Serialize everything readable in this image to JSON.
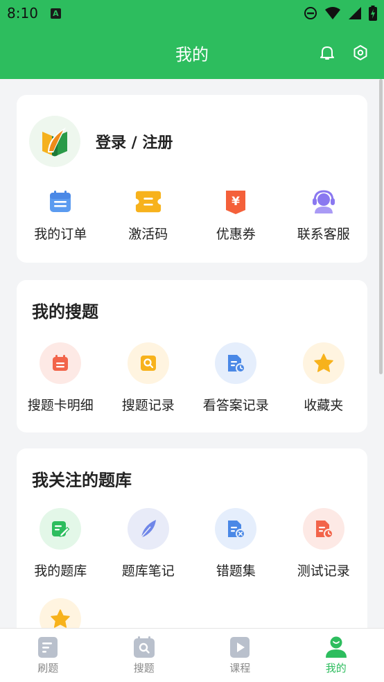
{
  "status": {
    "time": "8:10",
    "app_icon_letter": "A"
  },
  "header": {
    "title": "我的"
  },
  "login": {
    "label": "登录 / 注册"
  },
  "account_items": [
    {
      "label": "我的订单",
      "icon": "order-icon"
    },
    {
      "label": "激活码",
      "icon": "ticket-icon"
    },
    {
      "label": "优惠券",
      "icon": "coupon-icon"
    },
    {
      "label": "联系客服",
      "icon": "support-icon"
    }
  ],
  "search_section": {
    "title": "我的搜题",
    "items": [
      {
        "label": "搜题卡明细",
        "icon": "calendar-icon"
      },
      {
        "label": "搜题记录",
        "icon": "search-doc-icon"
      },
      {
        "label": "看答案记录",
        "icon": "doc-clock-icon"
      },
      {
        "label": "收藏夹",
        "icon": "star-icon"
      }
    ]
  },
  "library_section": {
    "title": "我关注的题库",
    "items": [
      {
        "label": "我的题库",
        "icon": "note-edit-icon"
      },
      {
        "label": "题库笔记",
        "icon": "feather-icon"
      },
      {
        "label": "错题集",
        "icon": "doc-x-icon"
      },
      {
        "label": "测试记录",
        "icon": "doc-clock-icon"
      }
    ]
  },
  "bottom_nav": [
    {
      "label": "刷题",
      "icon": "practice-icon"
    },
    {
      "label": "搜题",
      "icon": "search-tab-icon"
    },
    {
      "label": "课程",
      "icon": "play-icon"
    },
    {
      "label": "我的",
      "icon": "profile-icon",
      "active": true
    }
  ],
  "colors": {
    "brand": "#2dbd5e",
    "inactive": "#888888"
  }
}
